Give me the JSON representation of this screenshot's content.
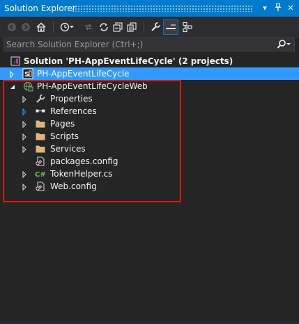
{
  "window": {
    "title": "Solution Explorer",
    "dropdown_glyph": "▾",
    "pin_glyph": "⊥",
    "close_glyph": "✕"
  },
  "toolbar": {
    "icons": [
      "back-icon",
      "forward-icon",
      "home-icon",
      "history-icon",
      "pending-changes-icon",
      "sync-icon",
      "refresh-icon",
      "collapse-all-icon",
      "show-all-files-icon",
      "properties-icon",
      "preview-selected-icon",
      "class-view-icon"
    ]
  },
  "search": {
    "placeholder": "Search Solution Explorer (Ctrl+;)"
  },
  "tree": {
    "solution": {
      "label": "Solution 'PH-AppEventLifeCycle' (2 projects)"
    },
    "project_app": {
      "label": "PH-AppEventLifeCycle",
      "expanded": false,
      "selected": true
    },
    "project_web": {
      "label": "PH-AppEventLifeCycleWeb",
      "expanded": true,
      "children": [
        {
          "label": "Properties",
          "icon": "wrench-icon",
          "expandable": true
        },
        {
          "label": "References",
          "icon": "references-icon",
          "expandable": true
        },
        {
          "label": "Pages",
          "icon": "folder-icon",
          "expandable": true
        },
        {
          "label": "Scripts",
          "icon": "folder-icon",
          "expandable": true
        },
        {
          "label": "Services",
          "icon": "folder-icon",
          "expandable": true
        },
        {
          "label": "packages.config",
          "icon": "config-file-icon",
          "expandable": false
        },
        {
          "label": "TokenHelper.cs",
          "icon": "csharp-file-icon",
          "expandable": true
        },
        {
          "label": "Web.config",
          "icon": "config-file-icon",
          "expandable": true
        }
      ]
    }
  },
  "colors": {
    "title_bar": "#007acc",
    "selection": "#3399ff",
    "background": "#252526",
    "highlight_box": "#e51400",
    "folder": "#dcb67a"
  }
}
